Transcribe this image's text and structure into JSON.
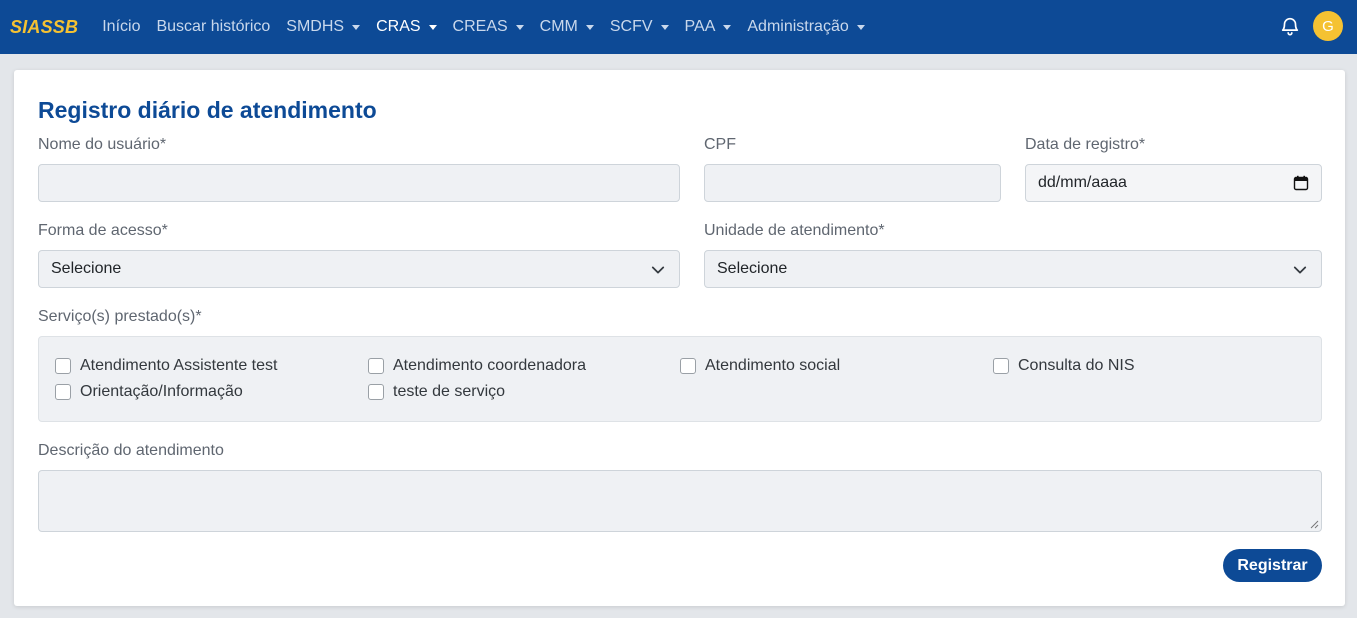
{
  "nav": {
    "brand": "SIASSB",
    "items": [
      {
        "label": "Início",
        "dropdown": false,
        "active": false
      },
      {
        "label": "Buscar histórico",
        "dropdown": false,
        "active": false
      },
      {
        "label": "SMDHS",
        "dropdown": true,
        "active": false
      },
      {
        "label": "CRAS",
        "dropdown": true,
        "active": true
      },
      {
        "label": "CREAS",
        "dropdown": true,
        "active": false
      },
      {
        "label": "CMM",
        "dropdown": true,
        "active": false
      },
      {
        "label": "SCFV",
        "dropdown": true,
        "active": false
      },
      {
        "label": "PAA",
        "dropdown": true,
        "active": false
      },
      {
        "label": "Administração",
        "dropdown": true,
        "active": false
      }
    ],
    "notification_icon": "bell-icon",
    "avatar_initial": "G"
  },
  "form": {
    "title": "Registro diário de atendimento",
    "nome_label": "Nome do usuário*",
    "nome_value": "",
    "cpf_label": "CPF",
    "cpf_value": "",
    "data_label": "Data de registro*",
    "data_value": "dd/mm/aaaa",
    "forma_label": "Forma de acesso*",
    "forma_value": "Selecione",
    "unidade_label": "Unidade de atendimento*",
    "unidade_value": "Selecione",
    "servicos_label": "Serviço(s) prestado(s)*",
    "servicos": [
      {
        "label": "Atendimento Assistente test",
        "checked": false
      },
      {
        "label": "Atendimento coordenadora",
        "checked": false
      },
      {
        "label": "Atendimento social",
        "checked": false
      },
      {
        "label": "Consulta do NIS",
        "checked": false
      },
      {
        "label": "Orientação/Informação",
        "checked": false
      },
      {
        "label": "teste de serviço",
        "checked": false
      }
    ],
    "descricao_label": "Descrição do atendimento",
    "descricao_value": "",
    "submit_label": "Registrar"
  },
  "colors": {
    "primary": "#0d4a96",
    "brand_accent": "#f5c232",
    "input_bg": "#eff1f4"
  }
}
